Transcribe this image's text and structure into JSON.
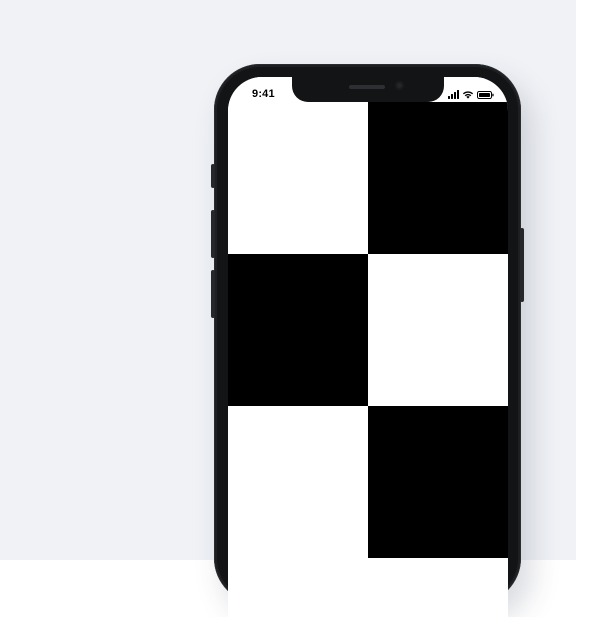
{
  "status_bar": {
    "time": "9:41",
    "icons": [
      "cellular-signal-icon",
      "wifi-icon",
      "battery-icon"
    ]
  },
  "board": {
    "columns": 2,
    "tiles": [
      {
        "color": "#ffffff"
      },
      {
        "color": "#000000"
      },
      {
        "color": "#000000"
      },
      {
        "color": "#ffffff"
      },
      {
        "color": "#ffffff"
      },
      {
        "color": "#000000"
      }
    ]
  },
  "colors": {
    "backdrop": "#f0f2f6",
    "phone_body": "#1e1f21",
    "tile_white": "#ffffff",
    "tile_black": "#000000"
  }
}
